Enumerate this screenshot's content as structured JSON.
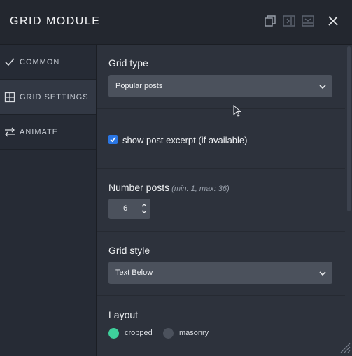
{
  "header": {
    "title": "GRID MODULE",
    "icons": [
      "duplicate-icon",
      "collapse-right-icon",
      "collapse-down-icon",
      "close-icon"
    ]
  },
  "sidebar": {
    "items": [
      {
        "label": "COMMON",
        "icon": "check-icon"
      },
      {
        "label": "GRID SETTINGS",
        "icon": "grid-icon",
        "active": true
      },
      {
        "label": "ANIMATE",
        "icon": "swap-arrows-icon"
      }
    ]
  },
  "main": {
    "grid_type": {
      "label": "Grid type",
      "value": "Popular posts"
    },
    "excerpt": {
      "label": "show post excerpt (if available)",
      "checked": true
    },
    "number_posts": {
      "label": "Number posts",
      "hint": "(min: 1, max: 36)",
      "value": "6"
    },
    "grid_style": {
      "label": "Grid style",
      "value": "Text Below"
    },
    "layout": {
      "label": "Layout",
      "options": [
        {
          "label": "cropped",
          "selected": true
        },
        {
          "label": "masonry",
          "selected": false
        }
      ]
    }
  },
  "colors": {
    "accent_selected": "#3ecf9b",
    "checkbox": "#2a76e4"
  }
}
